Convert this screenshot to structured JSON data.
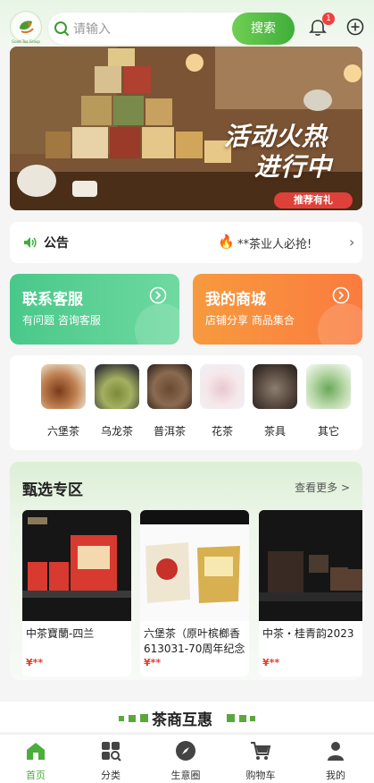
{
  "header": {
    "logo_caption": "Good Tea Group",
    "search_placeholder": "请输入",
    "search_button": "搜索",
    "notification_count": "1"
  },
  "banner": {
    "line1": "活动火热",
    "line2": "进行中",
    "tag": "推荐有礼"
  },
  "notice": {
    "label": "公告",
    "text": "**茶业人必抢!"
  },
  "cards": [
    {
      "title": "联系客服",
      "subtitle": "有问题 咨询客服"
    },
    {
      "title": "我的商城",
      "subtitle": "店铺分享 商品集合"
    }
  ],
  "categories": [
    {
      "label": "六堡茶"
    },
    {
      "label": "乌龙茶"
    },
    {
      "label": "普洱茶"
    },
    {
      "label": "花茶"
    },
    {
      "label": "茶具"
    },
    {
      "label": "其它"
    }
  ],
  "featured": {
    "title": "甄选专区",
    "more": "查看更多 >",
    "products": [
      {
        "name": "中茶寶蘭-四兰",
        "price": "¥**"
      },
      {
        "name": "六堡茶（原叶槟榔香613031-70周年纪念茶）",
        "price": "¥**"
      },
      {
        "name": "中茶・桂青韵2023",
        "price": "¥**"
      }
    ]
  },
  "section2": {
    "title": "茶商互惠"
  },
  "tabbar": [
    {
      "label": "首页"
    },
    {
      "label": "分类"
    },
    {
      "label": "生意圈"
    },
    {
      "label": "购物车"
    },
    {
      "label": "我的"
    }
  ],
  "colors": {
    "accent": "#4aae3a",
    "service_card": "#49c88a",
    "shop_card": "#fb7b3f",
    "price": "#e83a2a",
    "badge": "#f04040"
  }
}
